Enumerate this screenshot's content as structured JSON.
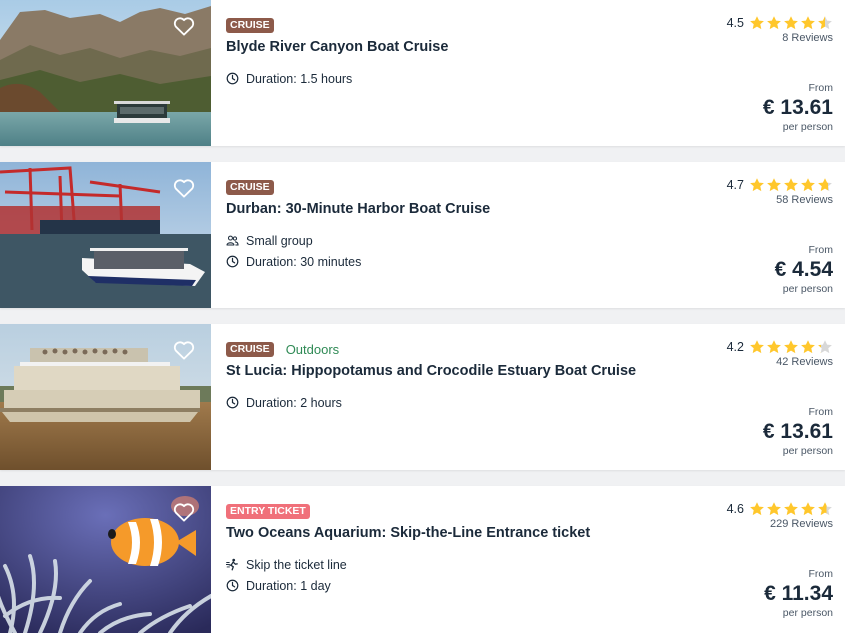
{
  "colors": {
    "cruise_badge": "#8d5a4a",
    "entry_badge": "#f0707a",
    "outdoors": "#2f8a55",
    "star": "#ffc72c",
    "star_empty": "#d8d8d8"
  },
  "activities": [
    {
      "badge": "CRUISE",
      "badge_type": "cruise",
      "extra_tag": "",
      "title": "Blyde River Canyon Boat Cruise",
      "features": [
        {
          "icon": "clock-icon",
          "text": "Duration: 1.5 hours"
        }
      ],
      "rating": "4.5",
      "rating_value": 4.5,
      "reviews": "8 Reviews",
      "from_label": "From",
      "price": "€ 13.61",
      "per_label": "per person",
      "image": "canyon-boat-image"
    },
    {
      "badge": "CRUISE",
      "badge_type": "cruise",
      "extra_tag": "",
      "title": "Durban: 30-Minute Harbor Boat Cruise",
      "features": [
        {
          "icon": "group-icon",
          "text": "Small group"
        },
        {
          "icon": "clock-icon",
          "text": "Duration: 30 minutes"
        }
      ],
      "rating": "4.7",
      "rating_value": 4.7,
      "reviews": "58 Reviews",
      "from_label": "From",
      "price": "€ 4.54",
      "per_label": "per person",
      "image": "harbor-boat-image"
    },
    {
      "badge": "CRUISE",
      "badge_type": "cruise",
      "extra_tag": "Outdoors",
      "title": "St Lucia: Hippopotamus and Crocodile Estuary Boat Cruise",
      "features": [
        {
          "icon": "clock-icon",
          "text": "Duration: 2 hours"
        }
      ],
      "rating": "4.2",
      "rating_value": 4.2,
      "reviews": "42 Reviews",
      "from_label": "From",
      "price": "€ 13.61",
      "per_label": "per person",
      "image": "estuary-boat-image"
    },
    {
      "badge": "ENTRY TICKET",
      "badge_type": "entry",
      "extra_tag": "",
      "title": "Two Oceans Aquarium: Skip-the-Line Entrance ticket",
      "features": [
        {
          "icon": "skip-line-icon",
          "text": "Skip the ticket line"
        },
        {
          "icon": "clock-icon",
          "text": "Duration: 1 day"
        }
      ],
      "rating": "4.6",
      "rating_value": 4.6,
      "reviews": "229 Reviews",
      "from_label": "From",
      "price": "€ 11.34",
      "per_label": "per person",
      "image": "aquarium-clownfish-image"
    }
  ]
}
